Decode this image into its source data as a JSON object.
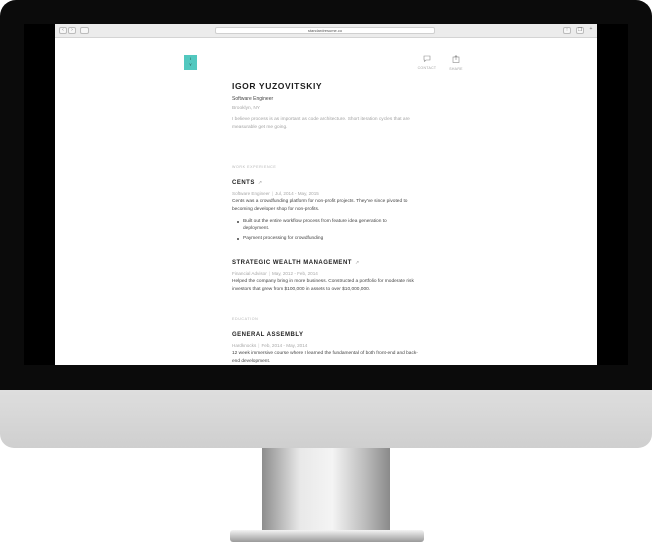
{
  "browser": {
    "url": "standardresume.co"
  },
  "profile": {
    "logo_line1": "I",
    "logo_line2": "Y",
    "name": "IGOR YUZOVITSKIY",
    "title": "Software Engineer",
    "location": "Brooklyn, NY",
    "bio": "I believe process is as important as code architecture. Short iteration cycles that are measurable get me going."
  },
  "actions": {
    "contact_label": "CONTACT",
    "share_label": "SHARE"
  },
  "work": {
    "section_label": "WORK EXPERIENCE",
    "jobs": [
      {
        "company": "CENTS",
        "role": "Software Engineer",
        "dates": "Jul, 2014 - May, 2015",
        "description": "Cents was a crowdfunding platform for non-profit projects. They've since pivoted to becoming developer shop for non-profits.",
        "bullets": [
          "Built out the entire workflow process from feature idea generation to deployment.",
          "Payment processing for crowdfunding"
        ]
      },
      {
        "company": "STRATEGIC WEALTH MANAGEMENT",
        "role": "Financial Advisor",
        "dates": "May, 2012 - Feb, 2014",
        "description": "Helped the company bring in more business. Constructed a portfolio for moderate risk investors that grew from $100,000 in assets to over $10,000,000."
      }
    ]
  },
  "education": {
    "section_label": "EDUCATION",
    "schools": [
      {
        "name": "GENERAL ASSEMBLY",
        "program": "Hardknocks",
        "dates": "Feb, 2014 - May, 2014",
        "description": "12 week immersive course where I learned the fundamental of both front-end and back-end development."
      }
    ]
  },
  "icons": {
    "contact": "chat-bubble-icon",
    "share": "share-icon",
    "external_link": "external-link-arrow-icon"
  },
  "colors": {
    "logo_bg": "#52c8bf"
  }
}
